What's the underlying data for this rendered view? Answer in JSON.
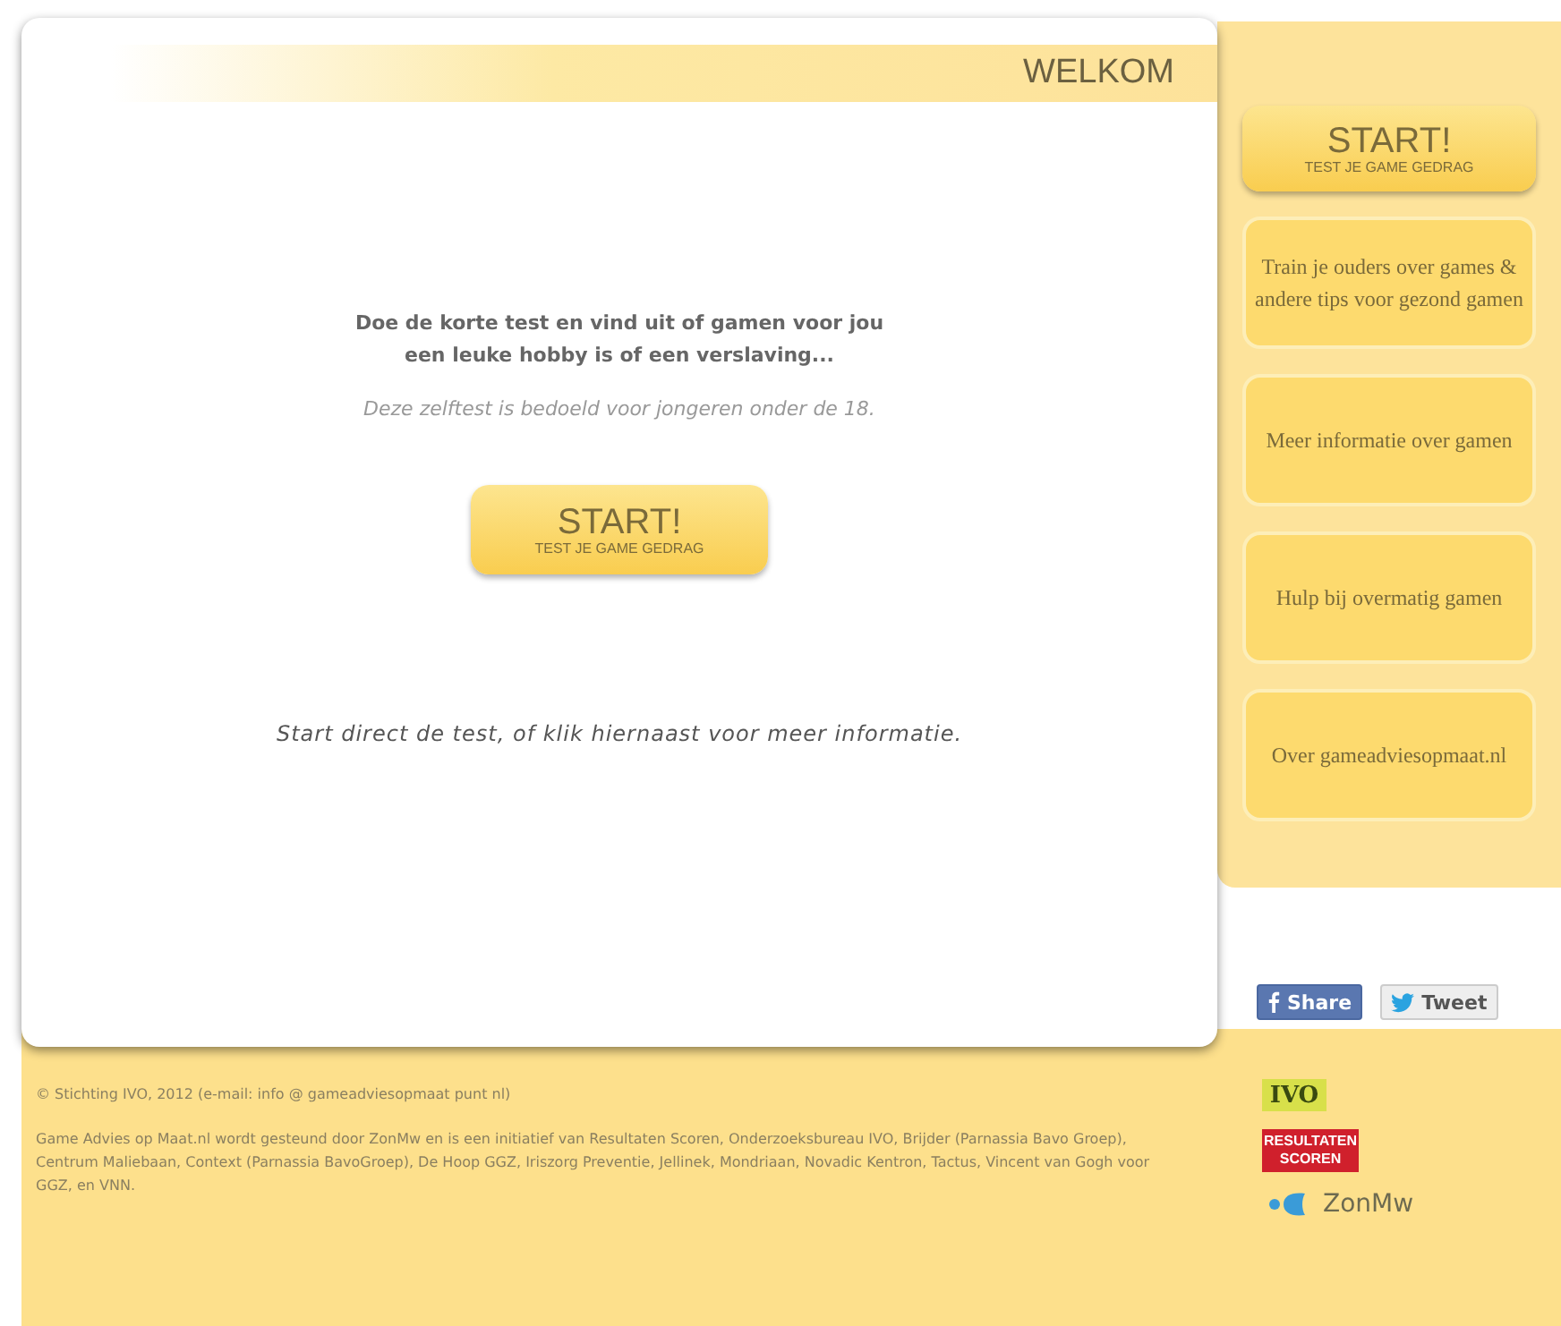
{
  "header": {
    "title": "WELKOM"
  },
  "intro": {
    "lines": [
      "Doe de korte test en vind uit of gamen voor jou",
      "een leuke hobby is of een verslaving..."
    ],
    "note": "Deze zelftest is bedoeld voor jongeren onder de 18."
  },
  "start_button": {
    "title": "START!",
    "subtitle": "TEST JE GAME GEDRAG"
  },
  "hint": "Start direct de test, of klik hiernaast voor meer informatie.",
  "sidebar": {
    "items": [
      {
        "kind": "start",
        "title": "START!",
        "subtitle": "TEST JE GAME GEDRAG"
      },
      {
        "kind": "link",
        "label": "Train je ouders over games & andere tips voor gezond gamen"
      },
      {
        "kind": "link",
        "label": "Meer informatie over gamen"
      },
      {
        "kind": "link",
        "label": "Hulp bij overmatig gamen"
      },
      {
        "kind": "link",
        "label": "Over gameadviesopmaat.nl"
      }
    ]
  },
  "share": [
    {
      "kind": "facebook",
      "label": "Share"
    },
    {
      "kind": "twitter",
      "label": "Tweet"
    }
  ],
  "footer": {
    "copyright": "© Stichting IVO, 2012 (e-mail: info @ gameadviesopmaat punt nl)",
    "credits": "Game Advies op Maat.nl wordt gesteund door ZonMw en is een initiatief van Resultaten Scoren, Onderzoeksbureau IVO, Brijder (Parnassia Bavo Groep), Centrum Maliebaan, Context (Parnassia BavoGroep), De Hoop GGZ, Iriszorg Preventie, Jellinek, Mondriaan, Novadic Kentron, Tactus, Vincent van Gogh voor GGZ, en VNN."
  },
  "logos": [
    {
      "kind": "ivo",
      "text": "IVO"
    },
    {
      "kind": "resultaten",
      "lines": [
        "RESULTATEN",
        "SCOREN"
      ]
    },
    {
      "kind": "zonmw",
      "text": "ZonMw"
    }
  ]
}
